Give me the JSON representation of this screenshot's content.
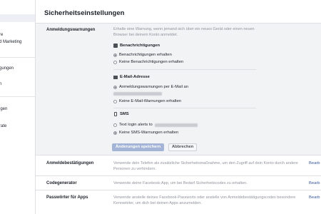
{
  "sidebar": {
    "items": [
      {
        "label": "re"
      },
      {
        "label": "d Marketing"
      },
      {
        "label": ""
      },
      {
        "label": "gungen"
      },
      {
        "label": "n"
      },
      {
        "label": "igen"
      },
      {
        "label": "rate"
      }
    ]
  },
  "page_title": "Sicherheitseinstellungen",
  "login_alerts": {
    "label": "Anmeldungswarnungen",
    "description": "Erhalte eine Warnung, wenn jemand sich über ein neues Gerät oder einen neuen Browser bei deinem Konto anmeldet.",
    "notifications": {
      "heading": "Benachrichtigungen",
      "icon": "notification-icon",
      "options": [
        {
          "label": "Benachrichtigungen erhalten",
          "selected": true
        },
        {
          "label": "Keine Benachrichtigungen erhalten",
          "selected": false
        }
      ]
    },
    "email": {
      "heading": "E-Mail-Adresse",
      "icon": "envelope-icon",
      "options": [
        {
          "label": "Anmeldungswarnungen per E-Mail an",
          "selected": true
        },
        {
          "label": "Keine E-Mail-Warnungen erhalten",
          "selected": false
        }
      ]
    },
    "sms": {
      "heading": "SMS",
      "icon": "phone-icon",
      "options": [
        {
          "label": "Text login alerts to",
          "selected": false
        },
        {
          "label": "Keine SMS-Warnungen erhalten",
          "selected": true
        }
      ]
    },
    "save_label": "Änderungen speichern",
    "cancel_label": "Abbrechen"
  },
  "rows": [
    {
      "label": "Anmeldebestätigungen",
      "description": "Verwende dein Telefon als zusätzliche Sicherheitsmaßnahme, um den Zugriff auf dein Konto durch andere Personen zu verhindern.",
      "action": "Bearb"
    },
    {
      "label": "Codegenerator",
      "description": "Verwende deine Facebook-App, um bei Bedarf Sicherheitscodes zu erhalten.",
      "action": "Bearb"
    },
    {
      "label": "Passwörter für Apps",
      "description": "Verwende anstelle deines Facebook-Passworts oder anstelle von Anmeldebestätigungscodes besondere Kennwörter, um dich bei deinen Apps anzumelden.",
      "action": "Bearb"
    }
  ],
  "colors": {
    "link": "#385898",
    "expanded_bg": "#f2f3f5",
    "save_button": "#a3b4d6"
  }
}
